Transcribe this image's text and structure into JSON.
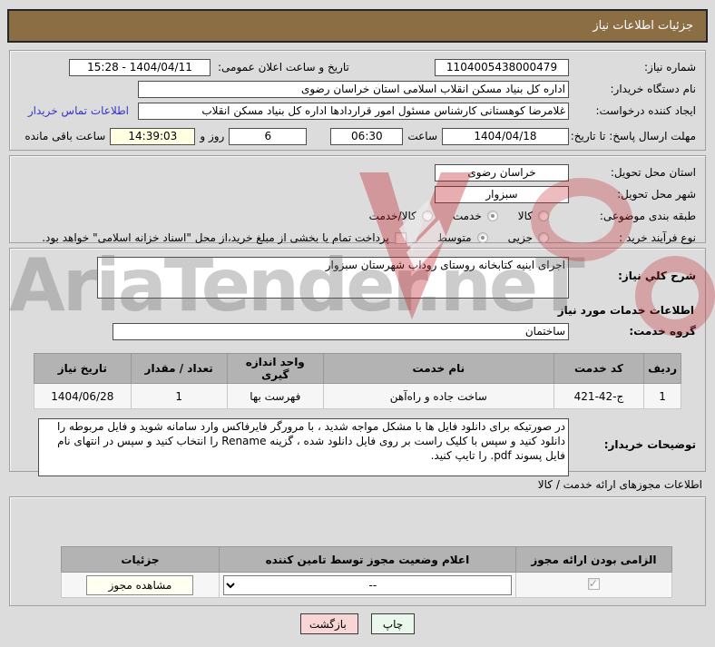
{
  "title_bar": {
    "label": "جزئیات اطلاعات نیاز"
  },
  "watermark": {
    "text": "AriaTender.neT"
  },
  "form1": {
    "need_number": {
      "label": "شماره نیاز:",
      "value": "1104005438000479"
    },
    "announce": {
      "label": "تاریخ و ساعت اعلان عمومی:",
      "value": "1404/04/11 - 15:28"
    },
    "buyer_org": {
      "label": "نام دستگاه خریدار:",
      "value": "اداره کل بنیاد مسکن انقلاب اسلامی استان خراسان رضوی"
    },
    "creator": {
      "label": "ایجاد کننده درخواست:",
      "value": "غلامرضا کوهستانی کارشناس مسئول امور قراردادها اداره کل بنیاد مسکن انقلاب",
      "contact_link": "اطلاعات تماس خریدار"
    },
    "deadline": {
      "label": "مهلت ارسال پاسخ: تا تاریخ:",
      "date": "1404/04/18",
      "hour_label": "ساعت",
      "hour": "06:30",
      "days": "6",
      "days_label": "روز و",
      "remaining": "14:39:03",
      "remaining_label": "ساعت باقی مانده"
    }
  },
  "form2": {
    "province": {
      "label": "استان محل تحویل:",
      "value": "خراسان رضوی"
    },
    "city": {
      "label": "شهر محل تحویل:",
      "value": "سبزوار"
    },
    "classification": {
      "label": "طبقه بندی موضوعی:",
      "options": [
        "کالا",
        "خدمت",
        "کالا/خدمت"
      ],
      "selected": "خدمت"
    },
    "process": {
      "label": "نوع فرآیند خرید :",
      "options": [
        "جزیی",
        "متوسط"
      ],
      "selected": "متوسط",
      "checkbox_label": "پرداخت تمام یا بخشی از مبلغ خرید،از محل \"اسناد خزانه اسلامی\" خواهد بود."
    }
  },
  "need_description": {
    "label": "شرح کلي نیاز:",
    "value": "اجرای ابنیه کتابخانه روستای روداب شهرستان سبزوار"
  },
  "services": {
    "header": "اطلاعات خدمات مورد نیاز",
    "group": {
      "label": "گروه خدمت:",
      "value": "ساختمان"
    },
    "table": {
      "columns": [
        "ردیف",
        "کد خدمت",
        "نام خدمت",
        "واحد اندازه گیری",
        "تعداد / مقدار",
        "تاریخ نیاز"
      ],
      "rows": [
        [
          "1",
          "ج-42-421",
          "ساخت جاده و راه‌آهن",
          "فهرست بها",
          "1",
          "1404/06/28"
        ]
      ]
    }
  },
  "buyer_notes": {
    "label": "توضیحات خریدار:",
    "value": "در صورتیکه برای دانلود فایل ها با مشکل مواجه شدید ، با مرورگر فایرفاکس وارد سامانه شوید و فایل مربوطه را دانلود کنید و سپس با کلیک راست بر روی فایل دانلود شده ، گزینه Rename را انتخاب کنید و سپس در انتهای نام فایل پسوند pdf. را تایپ کنید."
  },
  "licenses": {
    "header": "اطلاعات مجوزهای ارائه خدمت / کالا",
    "table": {
      "columns": [
        "الزامی بودن ارائه مجوز",
        "اعلام وضعیت مجوز توسط تامین کننده",
        "جزئیات"
      ],
      "select_value": "--",
      "details_button": "مشاهده مجوز"
    }
  },
  "footer": {
    "print_label": "چاپ",
    "back_label": "بازگشت"
  },
  "colors": {
    "titlebar": "#8c6e45",
    "link": "#3333cc",
    "remaining_bg": "#ffffe1",
    "table_header_bg": "#b3b3b3",
    "print_bg": "#e9f7ec",
    "back_bg": "#f9d6d6",
    "watermark_red": "#c0202a"
  }
}
